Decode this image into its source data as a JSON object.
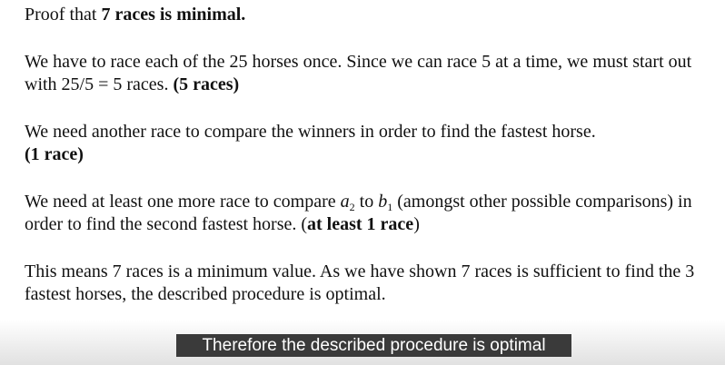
{
  "document": {
    "title_prefix": "Proof that ",
    "title_bold": "7 races is minimal.",
    "p1_text": "We have to race each of the 25 horses once. Since we can race 5 at a time, we must start out with 25/5 = 5 races. ",
    "p1_bold": "(5 races)",
    "p2_text": "We need another race to compare the winners in order to find the fastest horse. ",
    "p2_bold": "(1 race)",
    "p3_a": "We need at least one more race to compare ",
    "p3_var1": "a",
    "p3_sub1": "2",
    "p3_b": " to ",
    "p3_var2": "b",
    "p3_sub2": "1",
    "p3_c": " (amongst other possible comparisons) in order to find the second fastest horse. (",
    "p3_bold": "at least 1 race",
    "p3_d": ")",
    "p4_text": "This means 7 races is a minimum value. As we have shown 7 races is sufficient to find the 3 fastest horses, the described procedure is optimal."
  },
  "caption": "Therefore the described procedure is optimal"
}
